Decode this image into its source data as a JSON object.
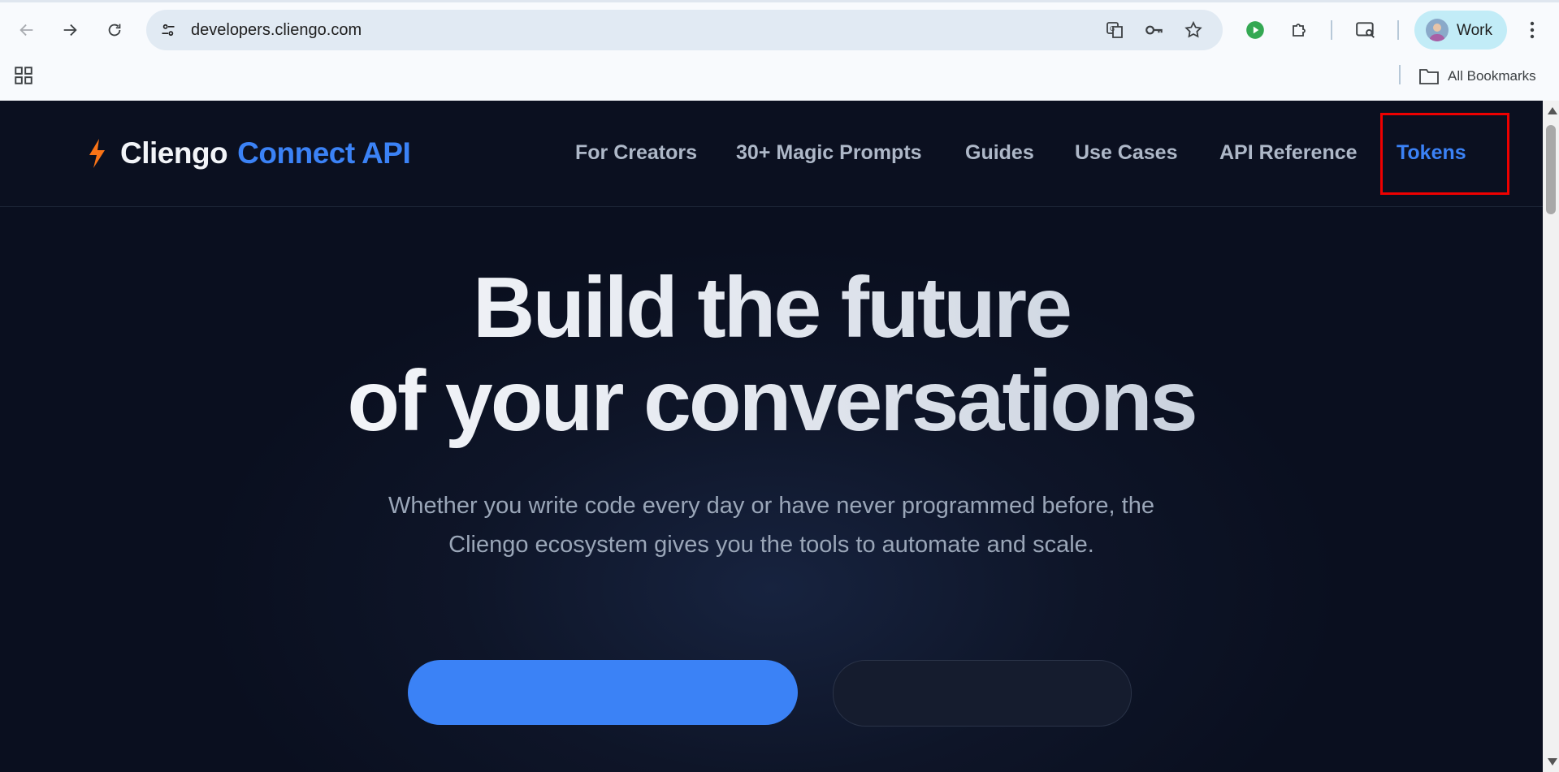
{
  "browser": {
    "url": "developers.cliengo.com",
    "profile_label": "Work",
    "bookmarks_label": "All Bookmarks"
  },
  "site": {
    "brand_name": "Cliengo",
    "brand_product": "Connect API",
    "nav": [
      {
        "label": "For Creators"
      },
      {
        "label": "30+ Magic Prompts"
      },
      {
        "label": "Guides"
      },
      {
        "label": "Use Cases"
      },
      {
        "label": "API Reference"
      },
      {
        "label": "Tokens"
      }
    ],
    "active_nav": "Tokens"
  },
  "hero": {
    "title_line1": "Build the future",
    "title_line2": "of your conversations",
    "subtitle": "Whether you write code every day or have never programmed before, the Cliengo ecosystem gives you the tools to automate and scale."
  },
  "colors": {
    "accent": "#3b82f6",
    "page_bg": "#0b1020",
    "highlight_box": "#ee0000",
    "bolt": "#f97316"
  }
}
